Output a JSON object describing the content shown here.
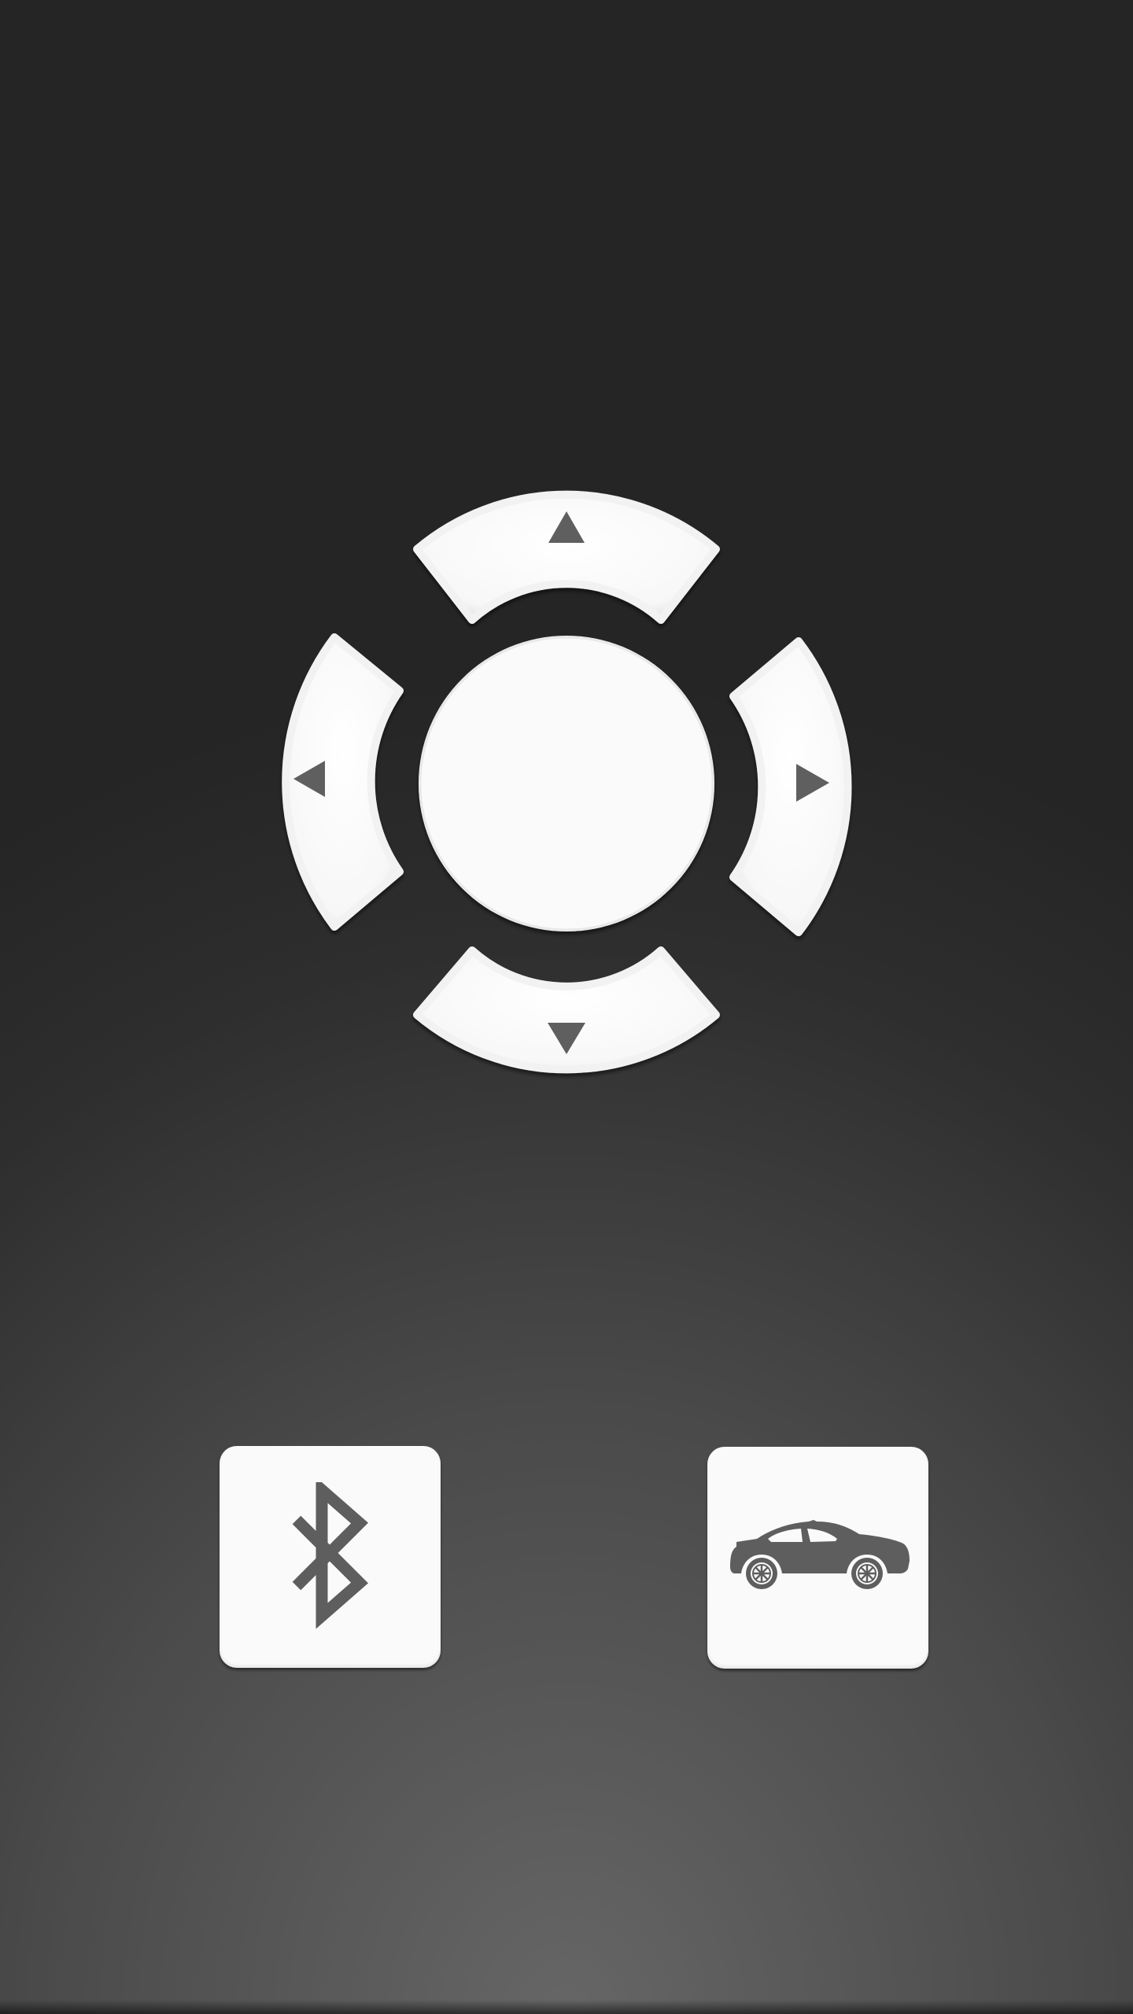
{
  "controls": {
    "dpad": {
      "up_icon": "triangle-up-icon",
      "down_icon": "triangle-down-icon",
      "left_icon": "triangle-left-icon",
      "right_icon": "triangle-right-icon",
      "center": "center-button"
    },
    "bluetooth_button": {
      "icon": "bluetooth-icon"
    },
    "car_button": {
      "icon": "car-icon"
    }
  },
  "colors": {
    "background_top": "#252525",
    "background_bottom": "#666666",
    "button_face": "#fafafa",
    "icon": "#5e5e5e"
  }
}
